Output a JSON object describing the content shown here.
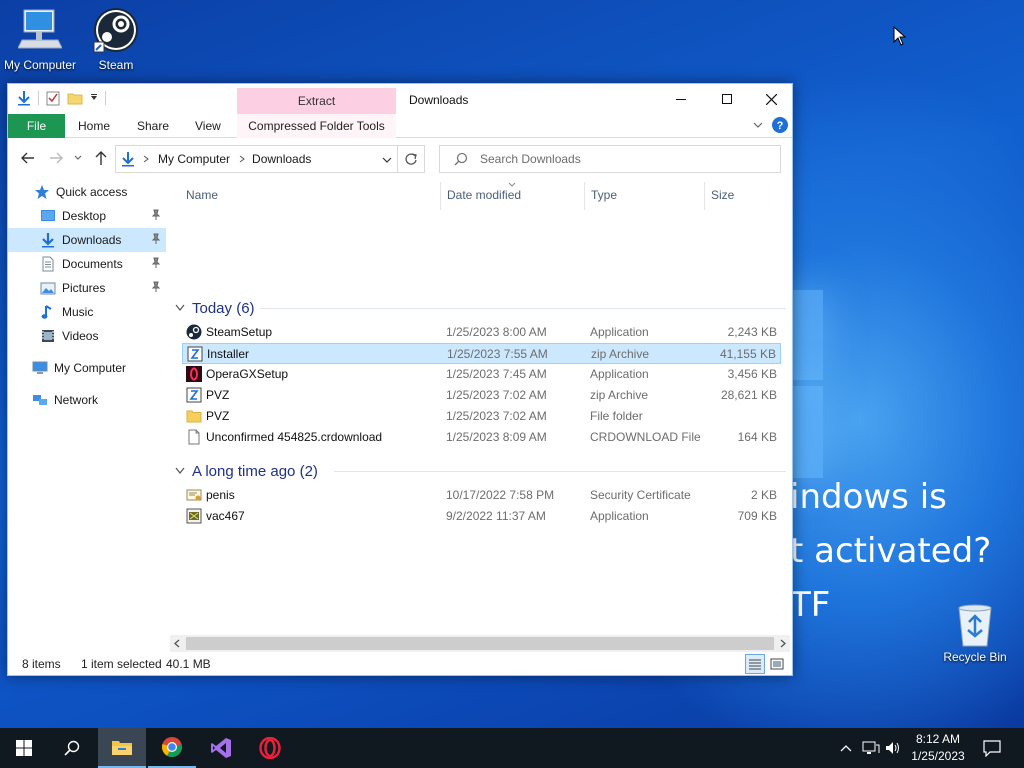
{
  "desktop": {
    "icons": [
      {
        "label": "My Computer"
      },
      {
        "label": "Steam"
      },
      {
        "label": "Recycle Bin"
      }
    ],
    "watermark_lines": [
      "indows is",
      "t activated?",
      "TF"
    ]
  },
  "explorer": {
    "title": "Downloads",
    "context_tab": "Extract",
    "ribbon": {
      "tabs": [
        "File",
        "Home",
        "Share",
        "View",
        "Compressed Folder Tools"
      ]
    },
    "address": {
      "crumbs": [
        "My Computer",
        "Downloads"
      ]
    },
    "search": {
      "placeholder": "Search Downloads"
    },
    "nav": {
      "quick_access": "Quick access",
      "items": [
        {
          "label": "Desktop",
          "icon": "desktop-icon",
          "pinned": true
        },
        {
          "label": "Downloads",
          "icon": "downloads-icon",
          "pinned": true,
          "selected": true
        },
        {
          "label": "Documents",
          "icon": "documents-icon",
          "pinned": true
        },
        {
          "label": "Pictures",
          "icon": "pictures-icon",
          "pinned": true
        },
        {
          "label": "Music",
          "icon": "music-icon",
          "pinned": false
        },
        {
          "label": "Videos",
          "icon": "videos-icon",
          "pinned": false
        }
      ],
      "my_computer": "My Computer",
      "network": "Network"
    },
    "columns": {
      "name": "Name",
      "date": "Date modified",
      "type": "Type",
      "size": "Size"
    },
    "groups": [
      {
        "title": "Today (6)",
        "files": [
          {
            "name": "SteamSetup",
            "date": "1/25/2023 8:00 AM",
            "type": "Application",
            "size": "2,243 KB",
            "icon": "steam-icon"
          },
          {
            "name": "Installer",
            "date": "1/25/2023 7:55 AM",
            "type": "zip Archive",
            "size": "41,155 KB",
            "icon": "zip-icon",
            "selected": true
          },
          {
            "name": "OperaGXSetup",
            "date": "1/25/2023 7:45 AM",
            "type": "Application",
            "size": "3,456 KB",
            "icon": "opera-gx-icon"
          },
          {
            "name": "PVZ",
            "date": "1/25/2023 7:02 AM",
            "type": "zip Archive",
            "size": "28,621 KB",
            "icon": "zip-icon"
          },
          {
            "name": "PVZ",
            "date": "1/25/2023 7:02 AM",
            "type": "File folder",
            "size": "",
            "icon": "folder-icon"
          },
          {
            "name": "Unconfirmed 454825.crdownload",
            "date": "1/25/2023 8:09 AM",
            "type": "CRDOWNLOAD File",
            "size": "164 KB",
            "icon": "file-icon"
          }
        ]
      },
      {
        "title": "A long time ago (2)",
        "files": [
          {
            "name": "penis",
            "date": "10/17/2022 7:58 PM",
            "type": "Security Certificate",
            "size": "2 KB",
            "icon": "certificate-icon"
          },
          {
            "name": "vac467",
            "date": "9/2/2022 11:37 AM",
            "type": "Application",
            "size": "709 KB",
            "icon": "app-icon"
          }
        ]
      }
    ],
    "status": {
      "items": "8 items",
      "selection": "1 item selected",
      "size": "40.1 MB"
    }
  },
  "taskbar": {
    "apps": [
      "start-icon",
      "search-icon",
      "file-explorer-icon",
      "chrome-icon",
      "visual-studio-icon",
      "opera-icon"
    ],
    "clock": {
      "time": "8:12 AM",
      "date": "1/25/2023"
    }
  },
  "colors": {
    "accent": "#1c9650",
    "selection": "#cce8ff",
    "context_tab": "#fccfe3",
    "group_title": "#1e3287"
  }
}
